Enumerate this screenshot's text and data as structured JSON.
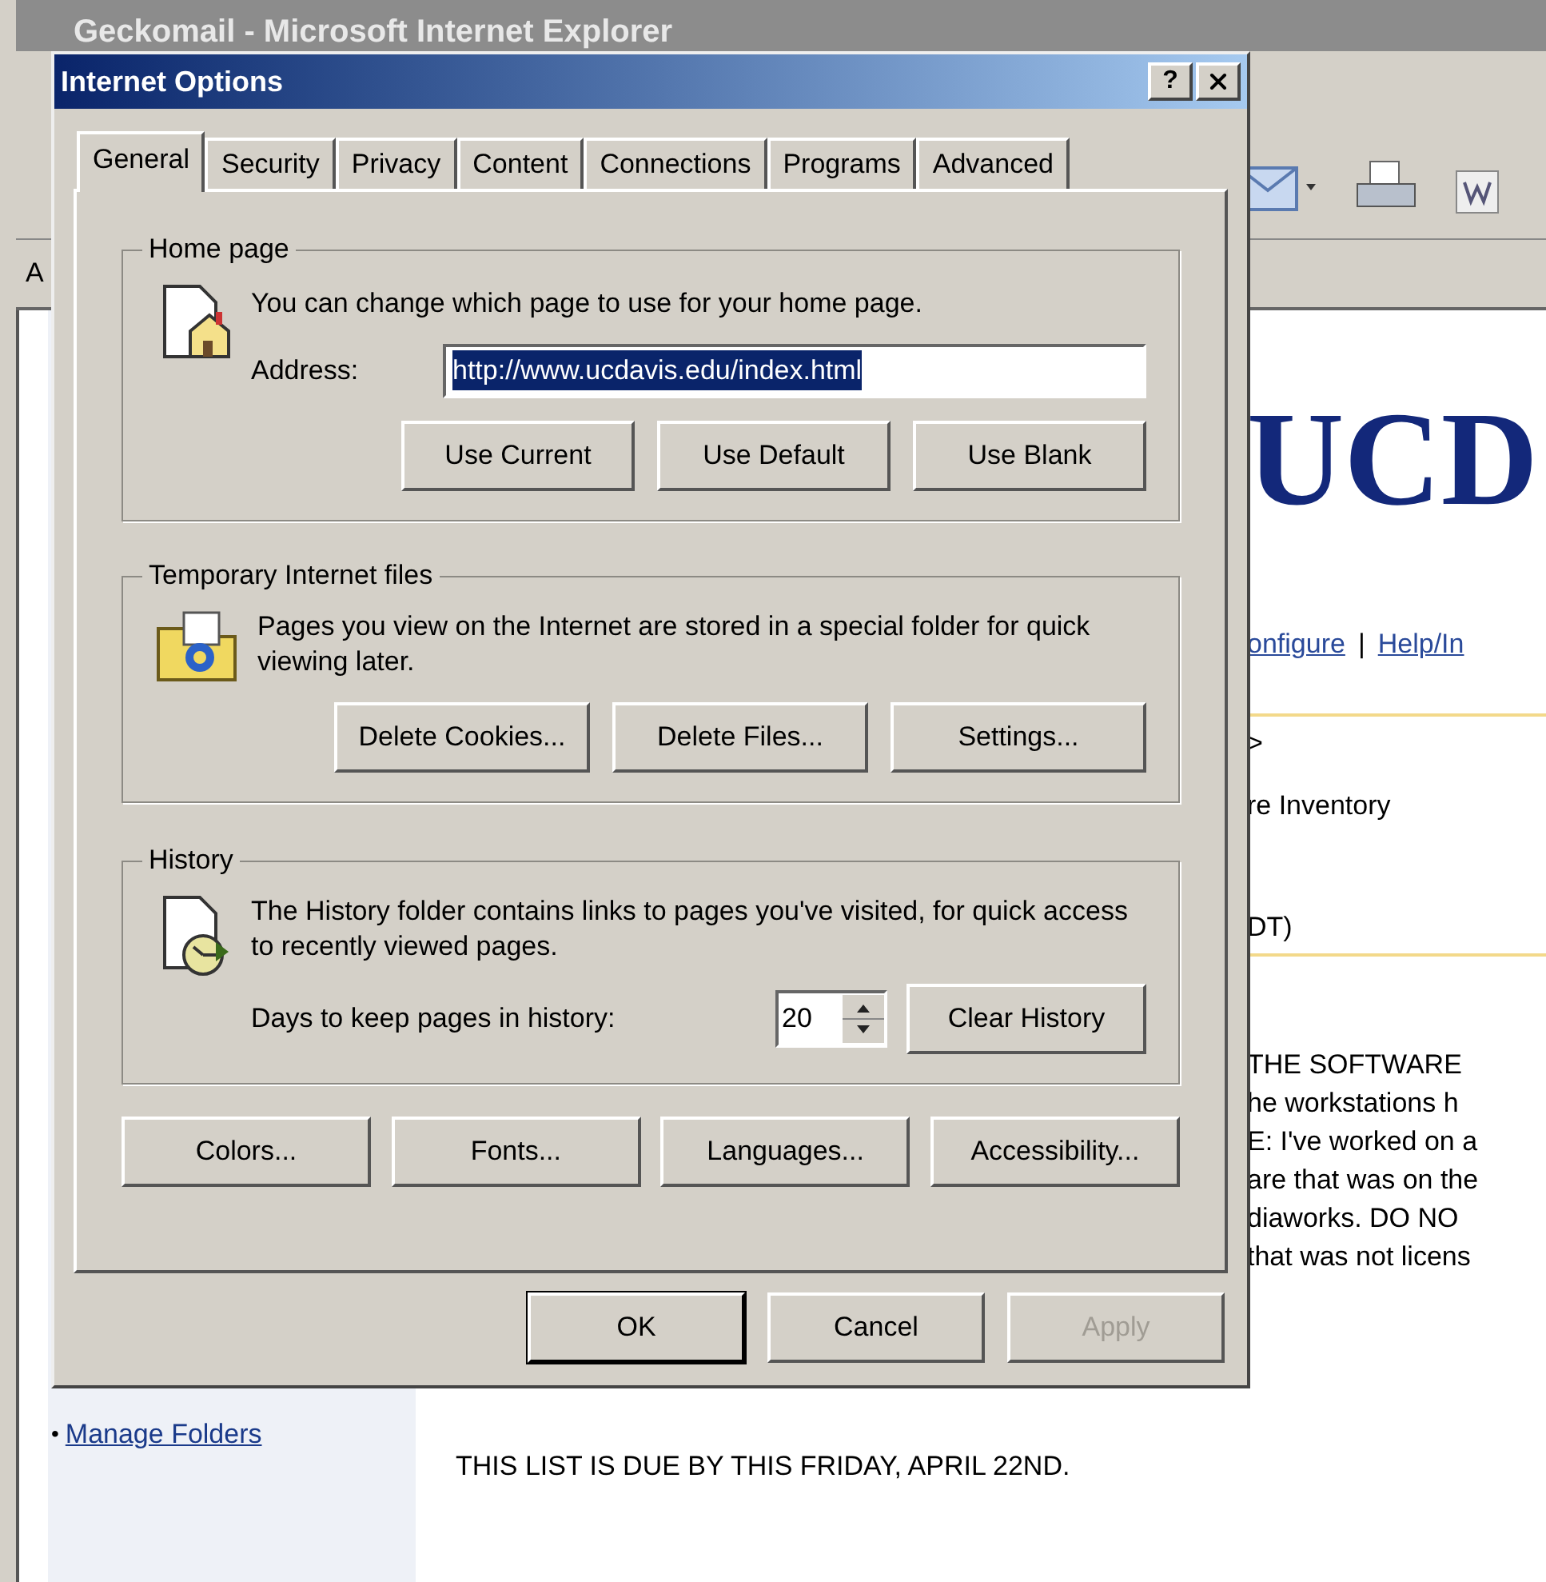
{
  "browser": {
    "title": "Geckomail - Microsoft Internet Explorer",
    "address_label": "A",
    "page": {
      "logo": "UCD",
      "links": [
        "onfigure",
        "Help/In"
      ],
      "link_separator": "|",
      "lines": [
        ">",
        "re Inventory",
        "DT)"
      ],
      "notice_lines": [
        "THE SOFTWARE",
        "he workstations h",
        "E: I've worked on a",
        "are that was on the",
        "diaworks.  DO NO",
        "that was not licens"
      ],
      "sidebar_link": "Manage Folders",
      "bullet": "•",
      "due_notice": "THIS LIST IS DUE BY THIS FRIDAY, APRIL 22ND."
    }
  },
  "dialog": {
    "title": "Internet Options",
    "help": "?",
    "tabs": [
      {
        "label": "General",
        "selected": true
      },
      {
        "label": "Security",
        "selected": false
      },
      {
        "label": "Privacy",
        "selected": false
      },
      {
        "label": "Content",
        "selected": false
      },
      {
        "label": "Connections",
        "selected": false
      },
      {
        "label": "Programs",
        "selected": false
      },
      {
        "label": "Advanced",
        "selected": false
      }
    ],
    "home_page": {
      "legend": "Home page",
      "description": "You can change which page to use for your home page.",
      "address_label": "Address:",
      "address_value": "http://www.ucdavis.edu/index.html",
      "address_selected": true,
      "buttons": [
        "Use Current",
        "Use Default",
        "Use Blank"
      ]
    },
    "temporary_files": {
      "legend": "Temporary Internet files",
      "description": "Pages you view on the Internet are stored in a special folder for quick viewing later.",
      "buttons": [
        "Delete Cookies...",
        "Delete Files...",
        "Settings..."
      ]
    },
    "history": {
      "legend": "History",
      "description": "The History folder contains links to pages you've visited, for quick access to recently viewed pages.",
      "days_label": "Days to keep pages in history:",
      "days_value": "20",
      "button": "Clear History"
    },
    "bottom_buttons": [
      "Colors...",
      "Fonts...",
      "Languages...",
      "Accessibility..."
    ],
    "footer_buttons": [
      {
        "label": "OK",
        "default": true,
        "disabled": false
      },
      {
        "label": "Cancel",
        "default": false,
        "disabled": false
      },
      {
        "label": "Apply",
        "default": false,
        "disabled": true
      }
    ]
  }
}
